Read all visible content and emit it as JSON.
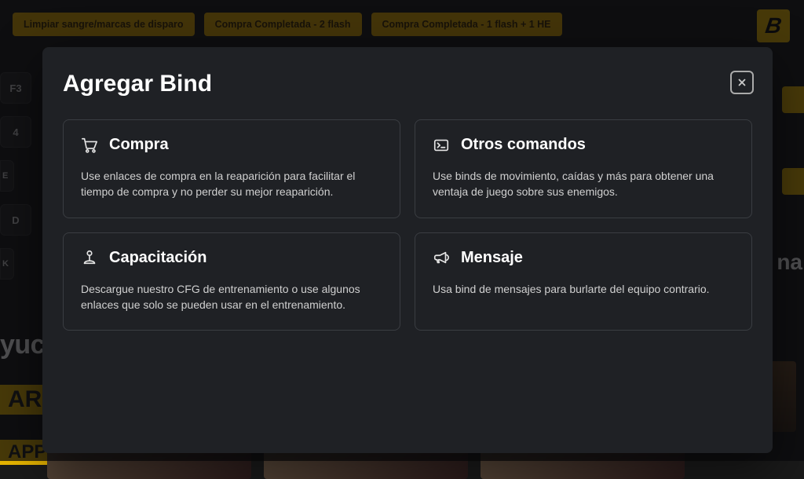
{
  "chips": [
    {
      "label": "Limpiar sangre/marcas de disparo"
    },
    {
      "label": "Compra Completada - 2 flash"
    },
    {
      "label": "Compra Completada - 1 flash + 1 HE"
    }
  ],
  "logo_letter": "B",
  "side_keys": [
    "F3",
    "4",
    "E",
    "D",
    "K"
  ],
  "help_fragment": "yuc",
  "yellow_fragments": {
    "a": "AR",
    "b": "APP"
  },
  "side_fragment": "na",
  "modal": {
    "title": "Agregar Bind",
    "close_aria": "Cerrar",
    "cards": [
      {
        "icon": "cart-icon",
        "title": "Compra",
        "desc": "Use enlaces de compra en la reaparición para facilitar el tiempo de compra y no perder su mejor reaparición."
      },
      {
        "icon": "terminal-icon",
        "title": "Otros comandos",
        "desc": "Use binds de movimiento, caídas y más para obtener una ventaja de juego sobre sus enemigos."
      },
      {
        "icon": "joystick-icon",
        "title": "Capacitación",
        "desc": "Descargue nuestro CFG de entrenamiento o use algunos enlaces que solo se pueden usar en el entrenamiento."
      },
      {
        "icon": "megaphone-icon",
        "title": "Mensaje",
        "desc": "Usa bind de mensajes para burlarte del equipo contrario."
      }
    ]
  }
}
